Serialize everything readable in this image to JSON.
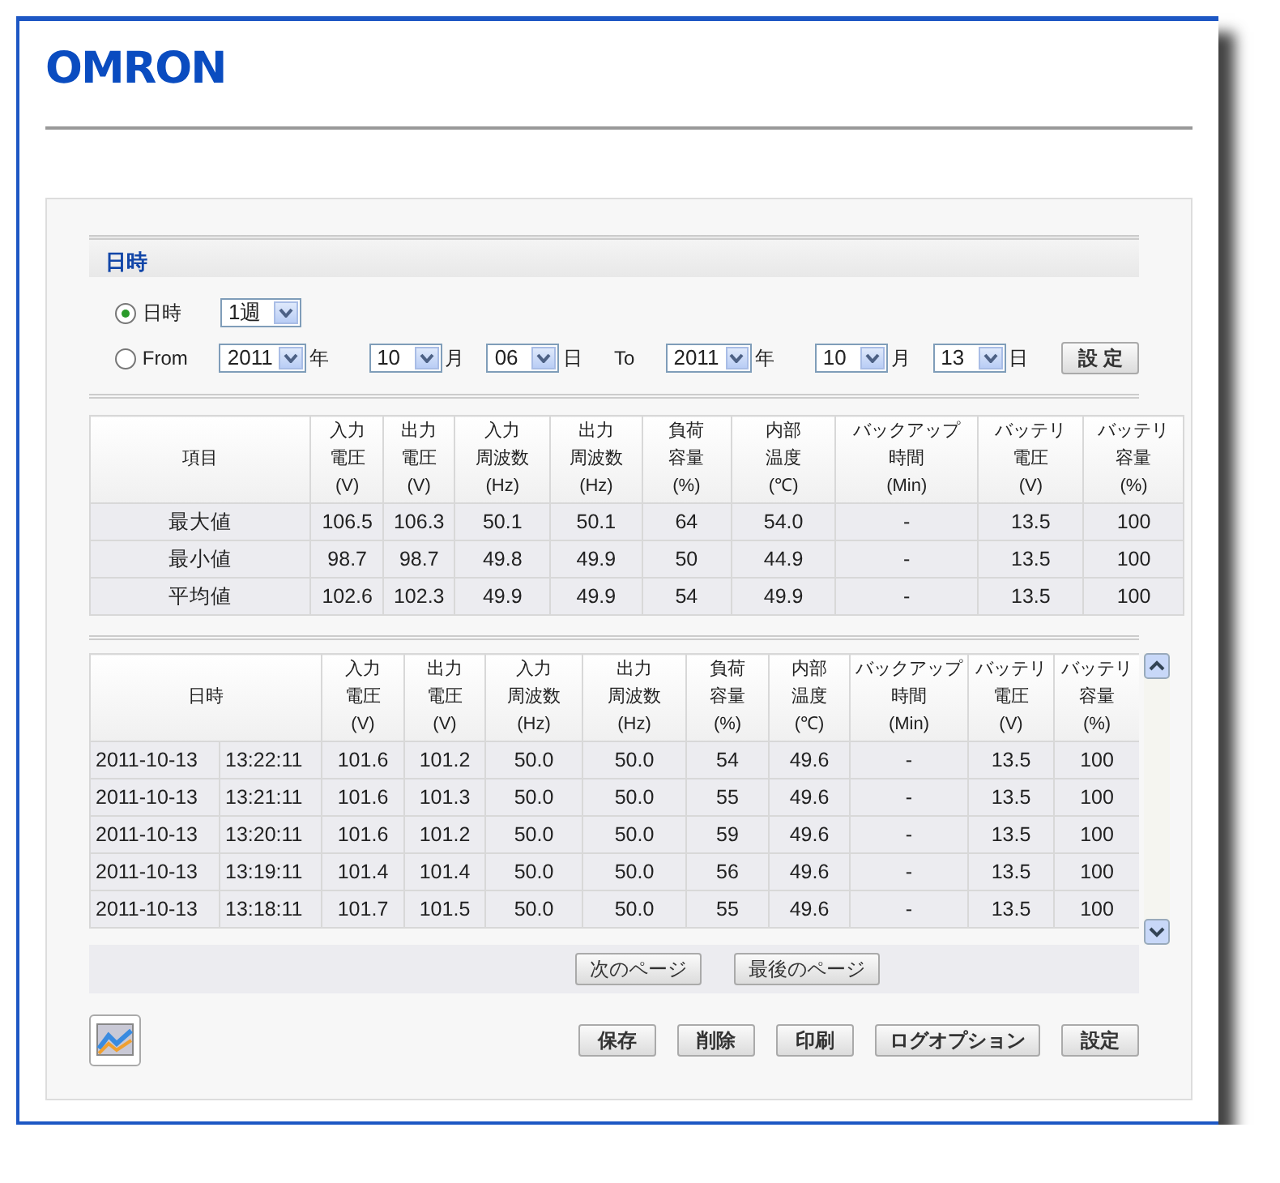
{
  "logo": "OMRON",
  "date_section": {
    "title": "日時",
    "options": [
      {
        "kind": "preset",
        "label": "日時",
        "selected": true,
        "period": "1週"
      },
      {
        "kind": "range",
        "label": "From",
        "selected": false,
        "from": [
          {
            "value": "2011",
            "unit": "年"
          },
          {
            "value": "10",
            "unit": "月"
          },
          {
            "value": "06",
            "unit": "日"
          }
        ],
        "to_label": "To",
        "to": [
          {
            "value": "2011",
            "unit": "年"
          },
          {
            "value": "10",
            "unit": "月"
          },
          {
            "value": "13",
            "unit": "日"
          }
        ],
        "button": "設 定"
      }
    ]
  },
  "summary_table": {
    "columns": [
      {
        "lines": [
          "項目"
        ]
      },
      {
        "lines": [
          "入力",
          "電圧",
          "(V)"
        ]
      },
      {
        "lines": [
          "出力",
          "電圧",
          "(V)"
        ]
      },
      {
        "lines": [
          "入力",
          "周波数",
          "(Hz)"
        ]
      },
      {
        "lines": [
          "出力",
          "周波数",
          "(Hz)"
        ]
      },
      {
        "lines": [
          "負荷",
          "容量",
          "(%)"
        ]
      },
      {
        "lines": [
          "内部",
          "温度",
          "(℃)"
        ]
      },
      {
        "lines": [
          "バックアップ",
          "時間",
          "(Min)"
        ]
      },
      {
        "lines": [
          "バッテリ",
          "電圧",
          "(V)"
        ]
      },
      {
        "lines": [
          "バッテリ",
          "容量",
          "(%)"
        ]
      }
    ],
    "rows": [
      [
        "最大値",
        "106.5",
        "106.3",
        "50.1",
        "50.1",
        "64",
        "54.0",
        "-",
        "13.5",
        "100"
      ],
      [
        "最小値",
        "98.7",
        "98.7",
        "49.8",
        "49.9",
        "50",
        "44.9",
        "-",
        "13.5",
        "100"
      ],
      [
        "平均値",
        "102.6",
        "102.3",
        "49.9",
        "49.9",
        "54",
        "49.9",
        "-",
        "13.5",
        "100"
      ]
    ]
  },
  "log_table": {
    "columns": [
      {
        "lines": [
          "日時"
        ]
      },
      {
        "lines": [
          "入力",
          "電圧",
          "(V)"
        ]
      },
      {
        "lines": [
          "出力",
          "電圧",
          "(V)"
        ]
      },
      {
        "lines": [
          "入力",
          "周波数",
          "(Hz)"
        ]
      },
      {
        "lines": [
          "出力",
          "周波数",
          "(Hz)"
        ]
      },
      {
        "lines": [
          "負荷",
          "容量",
          "(%)"
        ]
      },
      {
        "lines": [
          "内部",
          "温度",
          "(℃)"
        ]
      },
      {
        "lines": [
          "バックアップ",
          "時間",
          "(Min)"
        ]
      },
      {
        "lines": [
          "バッテリ",
          "電圧",
          "(V)"
        ]
      },
      {
        "lines": [
          "バッテリ",
          "容量",
          "(%)"
        ]
      }
    ],
    "rows": [
      {
        "date": "2011-10-13",
        "time": "13:22:11",
        "values": [
          "101.6",
          "101.2",
          "50.0",
          "50.0",
          "54",
          "49.6",
          "-",
          "13.5",
          "100"
        ]
      },
      {
        "date": "2011-10-13",
        "time": "13:21:11",
        "values": [
          "101.6",
          "101.3",
          "50.0",
          "50.0",
          "55",
          "49.6",
          "-",
          "13.5",
          "100"
        ]
      },
      {
        "date": "2011-10-13",
        "time": "13:20:11",
        "values": [
          "101.6",
          "101.2",
          "50.0",
          "50.0",
          "59",
          "49.6",
          "-",
          "13.5",
          "100"
        ]
      },
      {
        "date": "2011-10-13",
        "time": "13:19:11",
        "values": [
          "101.4",
          "101.4",
          "50.0",
          "50.0",
          "56",
          "49.6",
          "-",
          "13.5",
          "100"
        ]
      },
      {
        "date": "2011-10-13",
        "time": "13:18:11",
        "values": [
          "101.7",
          "101.5",
          "50.0",
          "50.0",
          "55",
          "49.6",
          "-",
          "13.5",
          "100"
        ]
      }
    ],
    "pager_buttons": [
      "次のページ",
      "最後のページ"
    ]
  },
  "footer_buttons": [
    "保存",
    "削除",
    "印刷",
    "ログオプション",
    "設定"
  ]
}
